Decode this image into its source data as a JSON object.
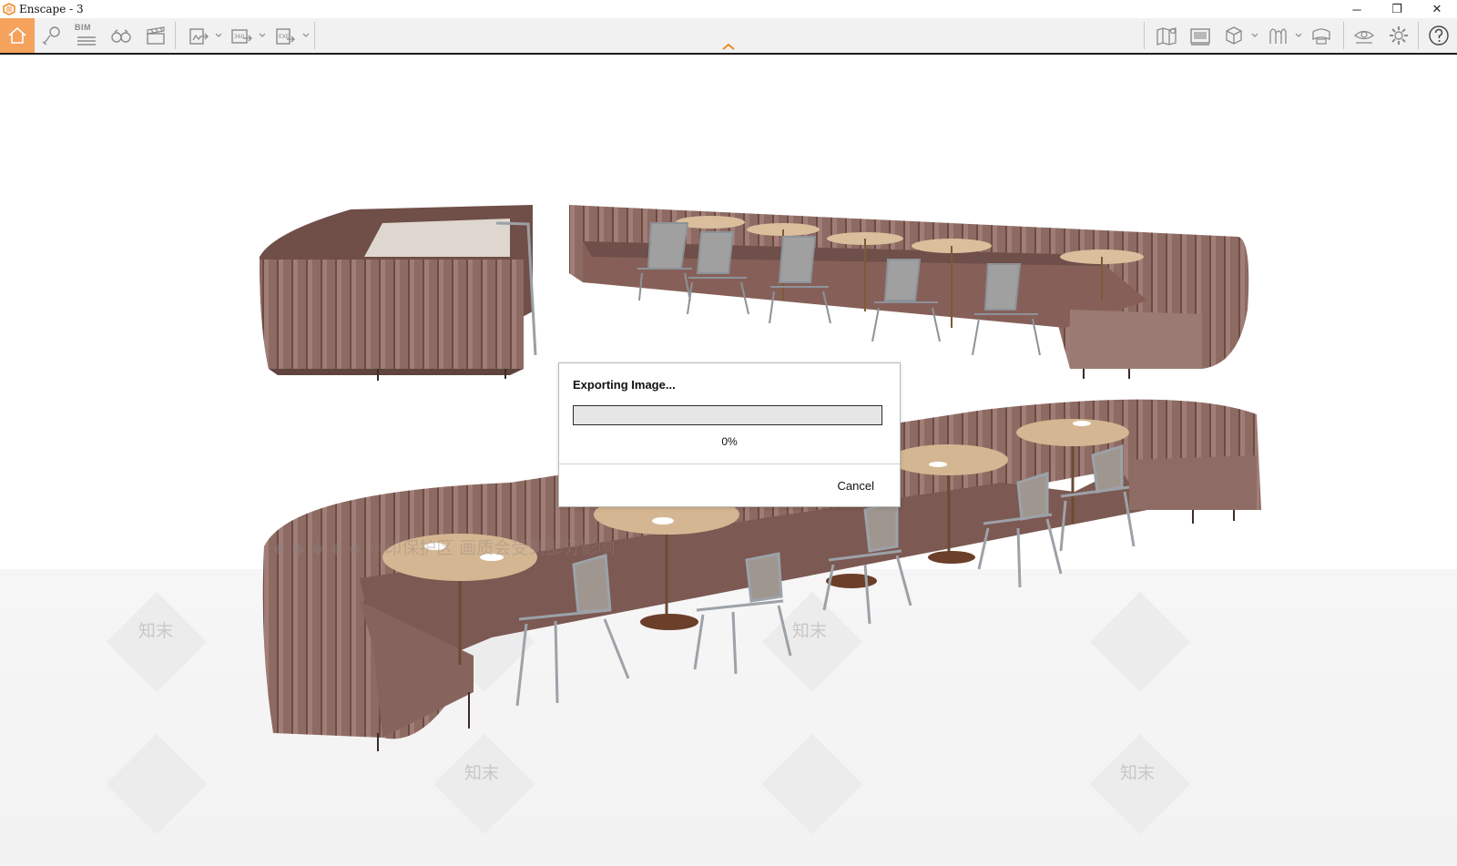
{
  "window": {
    "title": "Enscape - 3",
    "controls": {
      "minimize": "─",
      "restore": "❐",
      "close": "✕"
    }
  },
  "toolbar": {
    "bim_label": "BIM",
    "accent_color": "#f4a25c",
    "left_icons": [
      "home-icon",
      "pin-icon",
      "bim-icon",
      "binoculars-icon",
      "clapperboard-icon",
      "export-image-icon",
      "export-panorama-icon",
      "export-exe-icon"
    ],
    "right_icons": [
      "map-icon",
      "gallery-icon",
      "cube-icon",
      "asset-library-icon",
      "camera-icon",
      "visual-settings-icon",
      "settings-gear-icon",
      "help-icon"
    ]
  },
  "watermark": {
    "line": "◆ ◆ ◆ ◆   ◆  水印保护区  画质会受到部分影响",
    "brand": "知末"
  },
  "dialog": {
    "title": "Exporting Image...",
    "progress": 0,
    "progress_text": "0%",
    "cancel_label": "Cancel"
  }
}
